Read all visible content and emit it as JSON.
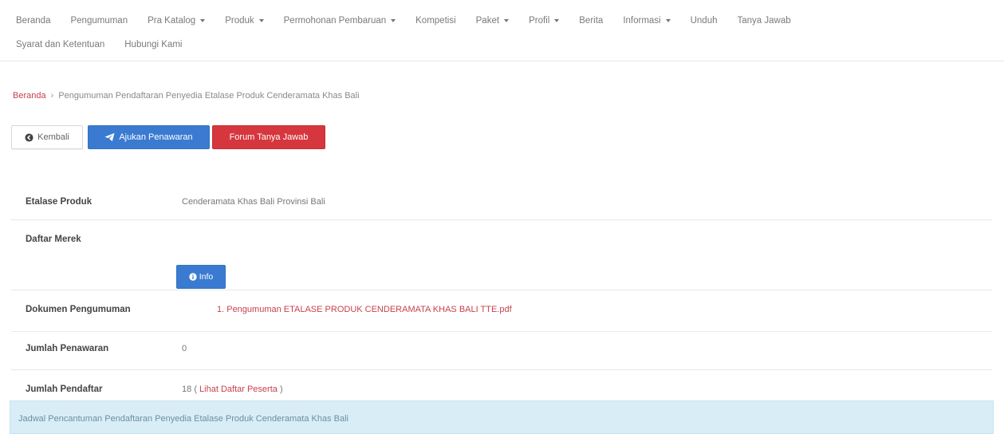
{
  "nav": {
    "row1": [
      {
        "label": "Beranda",
        "dropdown": false
      },
      {
        "label": "Pengumuman",
        "dropdown": false
      },
      {
        "label": "Pra Katalog",
        "dropdown": true
      },
      {
        "label": "Produk",
        "dropdown": true
      },
      {
        "label": "Permohonan Pembaruan",
        "dropdown": true
      },
      {
        "label": "Kompetisi",
        "dropdown": false
      },
      {
        "label": "Paket",
        "dropdown": true
      },
      {
        "label": "Profil",
        "dropdown": true
      },
      {
        "label": "Berita",
        "dropdown": false
      },
      {
        "label": "Informasi",
        "dropdown": true
      },
      {
        "label": "Unduh",
        "dropdown": false
      },
      {
        "label": "Tanya Jawab",
        "dropdown": false
      }
    ],
    "row2": [
      {
        "label": "Syarat dan Ketentuan",
        "dropdown": false
      },
      {
        "label": "Hubungi Kami",
        "dropdown": false
      }
    ]
  },
  "breadcrumb": {
    "home": "Beranda",
    "separator": "›",
    "current": "Pengumuman Pendaftaran Penyedia Etalase Produk Cenderamata Khas Bali"
  },
  "actions": {
    "back": "Kembali",
    "submit": "Ajukan Penawaran",
    "forum": "Forum Tanya Jawab"
  },
  "details": {
    "etalase": {
      "label": "Etalase Produk",
      "value": "Cenderamata Khas Bali Provinsi Bali"
    },
    "merek": {
      "label": "Daftar Merek",
      "button": "Info"
    },
    "dokumen": {
      "label": "Dokumen Pengumuman",
      "link": "1. Pengumuman ETALASE PRODUK CENDERAMATA KHAS BALI TTE.pdf"
    },
    "penawaran": {
      "label": "Jumlah Penawaran",
      "value": "0"
    },
    "pendaftar": {
      "label": "Jumlah Pendaftar",
      "count": "18",
      "open": "(",
      "link": "Lihat Daftar Peserta",
      "close": ")"
    }
  },
  "alert": {
    "text": "Jadwal Pencantuman Pendaftaran Penyedia Etalase Produk Cenderamata Khas Bali"
  },
  "colors": {
    "primary": "#3a7bd1",
    "danger": "#d6363d",
    "link": "#c9414f",
    "alert_bg": "#d9edf7"
  },
  "icons": {
    "back": "circle-arrow-left-icon",
    "submit": "paper-plane-icon",
    "info": "info-circle-icon",
    "dropdown": "caret-down-icon"
  }
}
